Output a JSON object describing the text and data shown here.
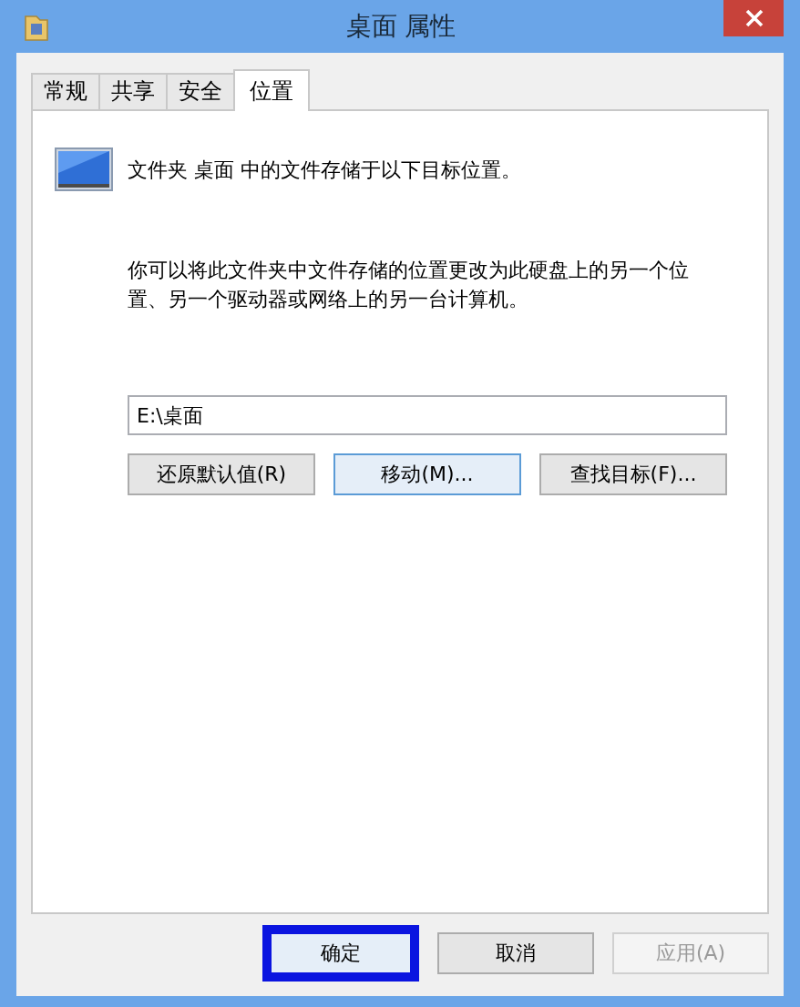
{
  "window": {
    "title": "桌面 属性"
  },
  "tabs": [
    {
      "label": "常规",
      "selected": false
    },
    {
      "label": "共享",
      "selected": false
    },
    {
      "label": "安全",
      "selected": false
    },
    {
      "label": "位置",
      "selected": true
    }
  ],
  "location": {
    "heading": "文件夹 桌面 中的文件存储于以下目标位置。",
    "description": "你可以将此文件夹中文件存储的位置更改为此硬盘上的另一个位置、另一个驱动器或网络上的另一台计算机。",
    "path": "E:\\桌面",
    "buttons": [
      {
        "label": "还原默认值(R)",
        "focused": false
      },
      {
        "label": "移动(M)...",
        "focused": true
      },
      {
        "label": "查找目标(F)...",
        "focused": false
      }
    ]
  },
  "dialog_buttons": [
    {
      "label": "确定",
      "default": true,
      "disabled": false
    },
    {
      "label": "取消",
      "default": false,
      "disabled": false
    },
    {
      "label": "应用(A)",
      "default": false,
      "disabled": true
    }
  ]
}
